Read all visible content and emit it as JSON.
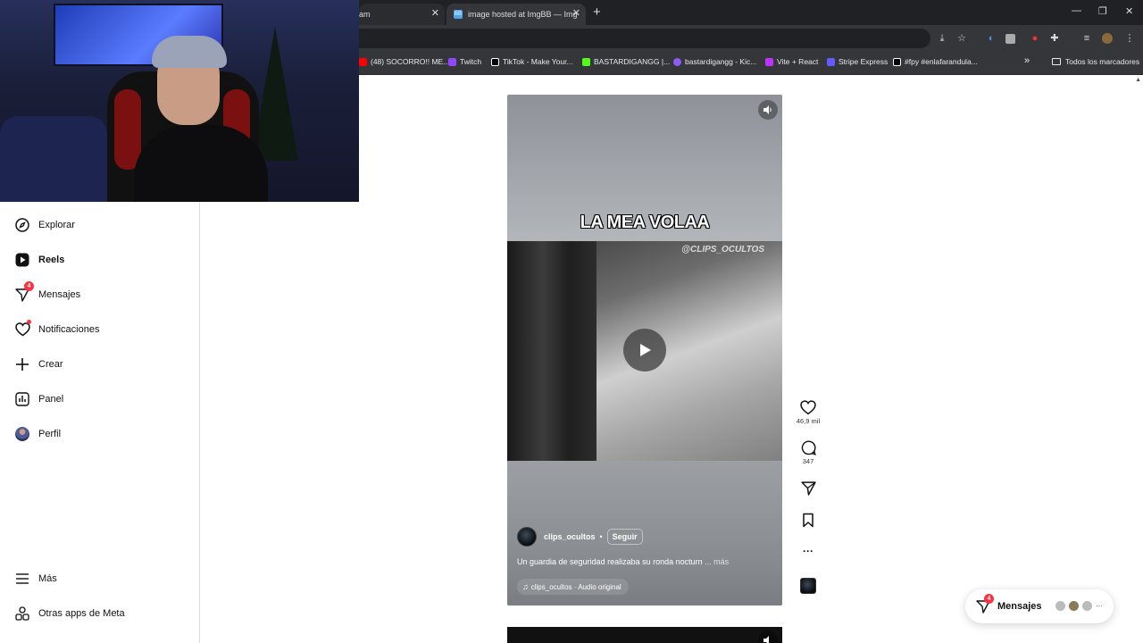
{
  "browser": {
    "left_tab_title": "am",
    "active_tab_title": "image hosted at ImgBB — Img",
    "active_tab_favicon_text": "BB",
    "new_tab_label": "+",
    "bookmarks": [
      {
        "label": "(48) SOCORRO!! ME...",
        "color": "#ff0000",
        "icon": "youtube-icon"
      },
      {
        "label": "Twitch",
        "color": "#9146ff",
        "icon": "twitch-icon"
      },
      {
        "label": "TikTok - Make Your...",
        "color": "#ffffff",
        "icon": "tiktok-icon"
      },
      {
        "label": "BASTARDIGANGG |...",
        "color": "#53fc18",
        "icon": "kick-icon"
      },
      {
        "label": "bastardigangg - Kic...",
        "color": "#8b5cf6",
        "icon": "kick-icon"
      },
      {
        "label": "Vite + React",
        "color": "#bd34fe",
        "icon": "vite-icon"
      },
      {
        "label": "Stripe Express",
        "color": "#635bff",
        "icon": "stripe-icon"
      },
      {
        "label": "#fpy #enlafarandula...",
        "color": "#ffffff",
        "icon": "tiktok-icon"
      }
    ],
    "bookmarks_overflow": "»",
    "all_bookmarks_label": "Todos los marcadores"
  },
  "sidebar": {
    "items": [
      {
        "key": "explore",
        "label": "Explorar",
        "icon": "compass-icon",
        "bold": false
      },
      {
        "key": "reels",
        "label": "Reels",
        "icon": "reels-icon",
        "bold": true
      },
      {
        "key": "messages",
        "label": "Mensajes",
        "icon": "messenger-icon",
        "bold": false,
        "badge": "4"
      },
      {
        "key": "notifications",
        "label": "Notificaciones",
        "icon": "heart-icon",
        "bold": false
      },
      {
        "key": "create",
        "label": "Crear",
        "icon": "plus-icon",
        "bold": false
      },
      {
        "key": "panel",
        "label": "Panel",
        "icon": "chart-icon",
        "bold": false
      },
      {
        "key": "profile",
        "label": "Perfil",
        "icon": "avatar-icon",
        "bold": false
      }
    ],
    "more_label": "Más",
    "meta_apps_label": "Otras apps de Meta"
  },
  "reel": {
    "caption_overlay": "LA MEA VOLAA",
    "watermark": "@CLIPS_OCULTOS",
    "author": "clips_ocultos",
    "separator": "•",
    "follow_label": "Seguir",
    "description": "Un guardia de seguridad realizaba su ronda nocturn",
    "description_more": "... más",
    "audio": "clips_ocultos · Audio original"
  },
  "actions": {
    "likes": "46,9 mil",
    "comments": "347"
  },
  "messages_pill": {
    "label": "Mensajes",
    "badge": "4",
    "more": "···"
  },
  "colors": {
    "notification_red": "#ff3040",
    "chrome_dark": "#202124",
    "chrome_toolbar": "#35363a"
  }
}
